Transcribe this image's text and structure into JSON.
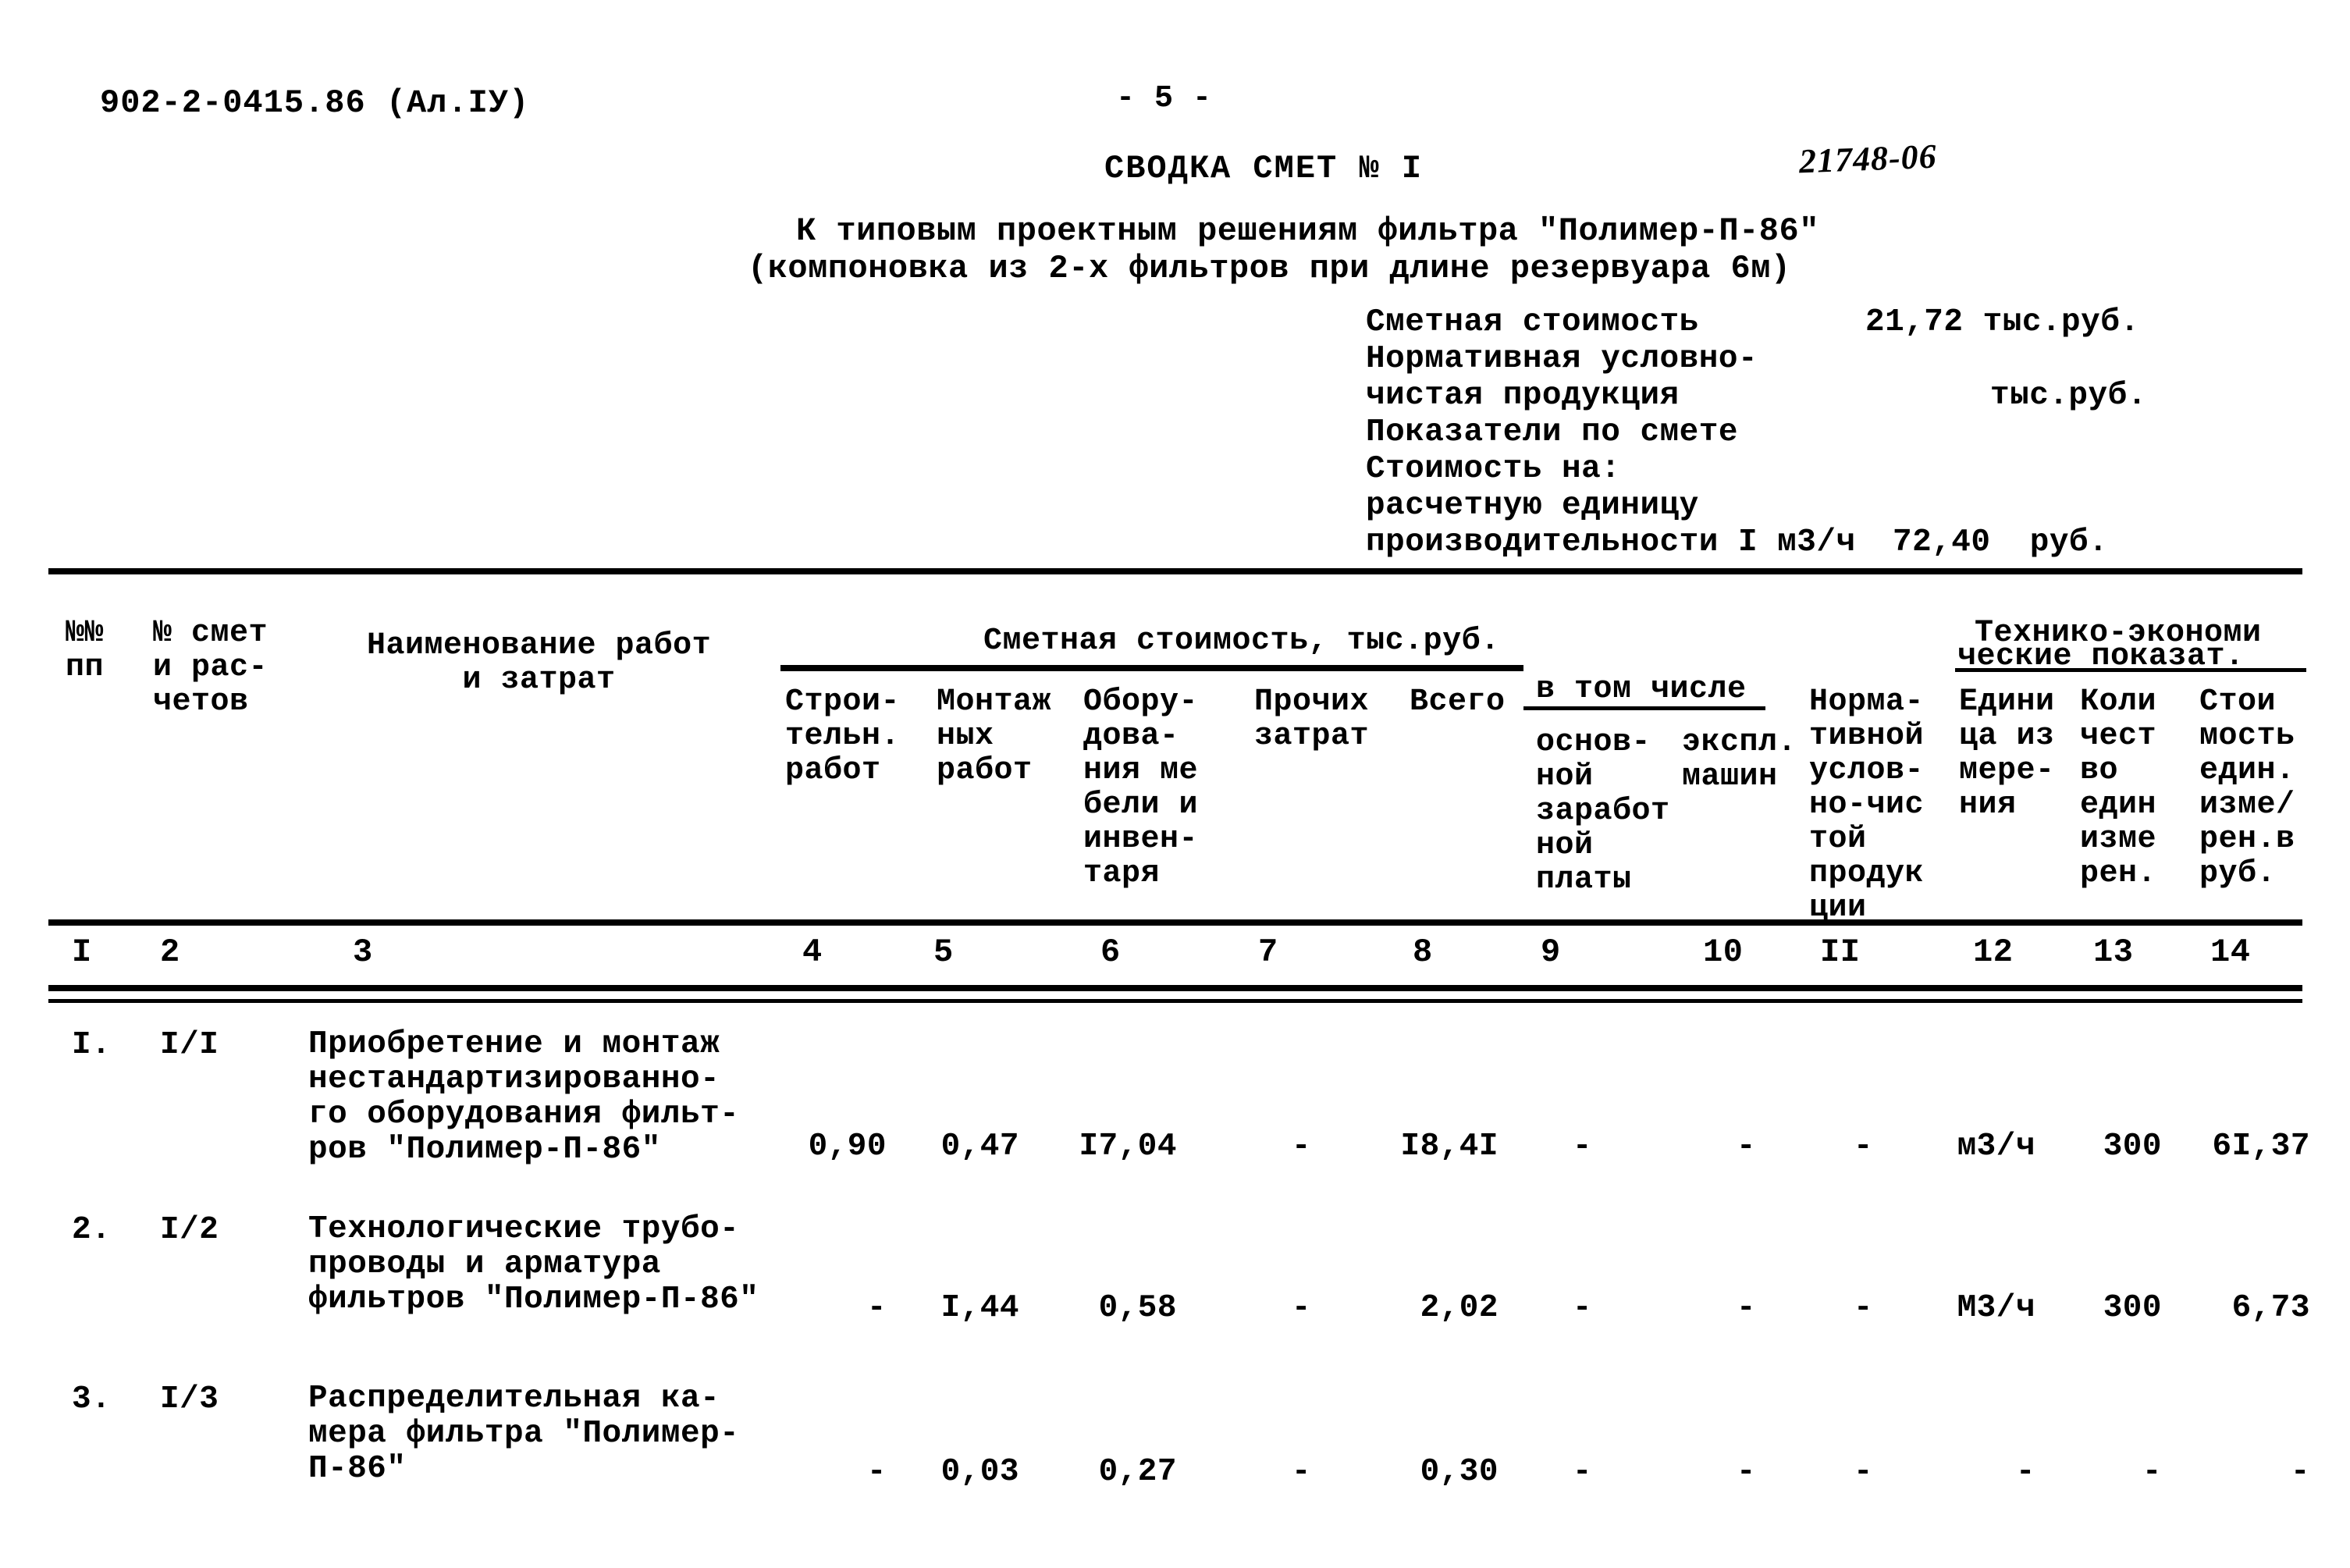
{
  "header": {
    "doc_code": "902-2-0415.86 (Ал.IУ)",
    "page_number": "- 5 -",
    "title": "СВОДКА СМЕТ № I",
    "stamp_number": "21748-06",
    "subtitle_line1": "К типовым проектным решениям фильтра \"Полимер-П-86\"",
    "subtitle_line2": "(компоновка из 2-х фильтров при длине резервуара 6м)"
  },
  "summary": {
    "rows": [
      {
        "label": "Сметная стоимость",
        "value": "21,72 тыс.руб."
      },
      {
        "label": "Нормативная условно-",
        "value": ""
      },
      {
        "label": "чистая продукция",
        "value": "тыс.руб."
      },
      {
        "label": "Показатели по смете",
        "value": ""
      },
      {
        "label": "Стоимость на:",
        "value": ""
      },
      {
        "label": "расчетную единицу",
        "value": ""
      },
      {
        "label": "производительности I м3/ч",
        "value": "72,40  руб."
      }
    ]
  },
  "table": {
    "group_headers": {
      "estimate_cost": "Сметная стоимость, тыс.руб.",
      "including": "в том числе",
      "tech_econ_line1": "Технико-экономи",
      "tech_econ_line2": "ческие показат."
    },
    "columns": [
      {
        "num": "I",
        "header": "№№\nпп"
      },
      {
        "num": "2",
        "header": "№ смет\nи рас-\nчетов"
      },
      {
        "num": "3",
        "header": "Наименование работ\nи затрат"
      },
      {
        "num": "4",
        "header": "Строи-\nтельн.\nработ"
      },
      {
        "num": "5",
        "header": "Монтаж\nных\nработ"
      },
      {
        "num": "6",
        "header": "Обору-\nдова-\nния ме\nбели и\nинвен-\nтаря"
      },
      {
        "num": "7",
        "header": "Прочих\nзатрат"
      },
      {
        "num": "8",
        "header": "Всего"
      },
      {
        "num": "9",
        "header": "основ-\nной\nзаработ\nной\nплаты"
      },
      {
        "num": "10",
        "header": "экспл.\nмашин"
      },
      {
        "num": "II",
        "header": "Норма-\nтивной\nуслов-\nно-чис\nтой\nпродук\nции"
      },
      {
        "num": "12",
        "header": "Едини\nца из\nмере-\nния"
      },
      {
        "num": "13",
        "header": "Коли\nчест\nво\nедин\nизме\nрен."
      },
      {
        "num": "14",
        "header": "Стои\nмость\nедин.\nизме/\nрен.в\nруб."
      }
    ],
    "rows": [
      {
        "pp": "I.",
        "estimate_no": "I/I",
        "description": "Приобретение и монтаж\nнестандартизированно-\nго оборудования фильт-\nров \"Полимер-П-86\"",
        "c4": "0,90",
        "c5": "0,47",
        "c6": "I7,04",
        "c7": "-",
        "c8": "I8,4I",
        "c9": "-",
        "c10": "-",
        "c11": "-",
        "c12": "м3/ч",
        "c13": "300",
        "c14": "6I,37"
      },
      {
        "pp": "2.",
        "estimate_no": "I/2",
        "description": "Технологические трубо-\nпроводы и арматура\nфильтров \"Полимер-П-86\"",
        "c4": "-",
        "c5": "I,44",
        "c6": "0,58",
        "c7": "-",
        "c8": "2,02",
        "c9": "-",
        "c10": "-",
        "c11": "-",
        "c12": "М3/ч",
        "c13": "300",
        "c14": "6,73"
      },
      {
        "pp": "3.",
        "estimate_no": "I/3",
        "description": "Распределительная ка-\nмера фильтра \"Полимер-\nП-86\"",
        "c4": "-",
        "c5": "0,03",
        "c6": "0,27",
        "c7": "-",
        "c8": "0,30",
        "c9": "-",
        "c10": "-",
        "c11": "-",
        "c12": "-",
        "c13": "-",
        "c14": "-"
      }
    ]
  }
}
